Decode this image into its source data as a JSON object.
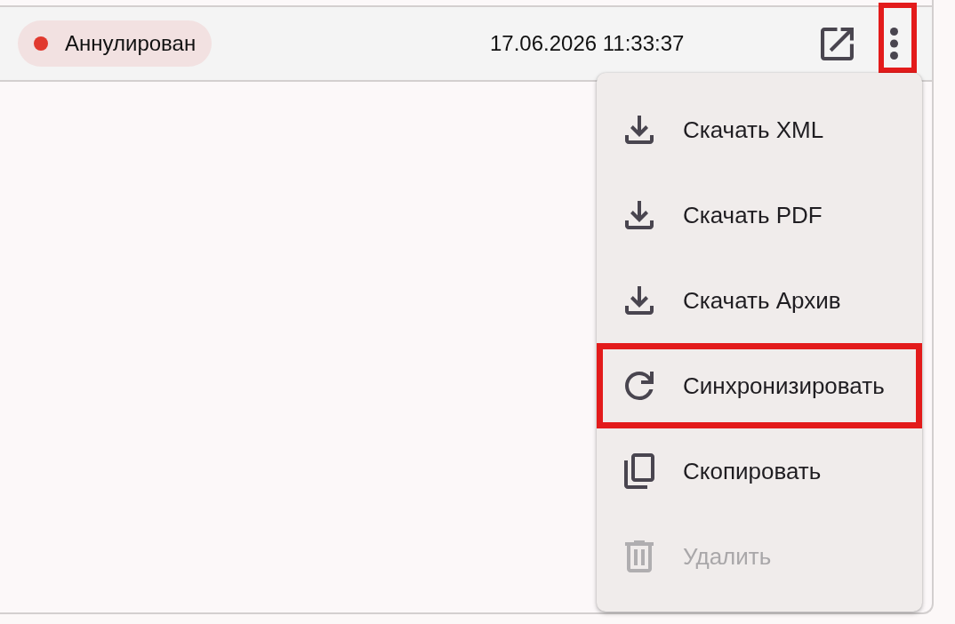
{
  "table": {
    "rows": [
      {
        "status": {
          "label": "Аннулирован",
          "color": "#e1392e"
        },
        "date": "17.06.2026 11:33:37",
        "actions": [
          {
            "kind": "open",
            "highlighted": false
          },
          {
            "kind": "more",
            "highlighted": true
          }
        ]
      }
    ]
  },
  "menu": {
    "items": [
      {
        "kind": "download",
        "label": "Скачать XML",
        "disabled": false,
        "highlighted": false
      },
      {
        "kind": "download",
        "label": "Скачать PDF",
        "disabled": false,
        "highlighted": false
      },
      {
        "kind": "download",
        "label": "Скачать Архив",
        "disabled": false,
        "highlighted": false
      },
      {
        "kind": "refresh",
        "label": "Синхронизировать",
        "disabled": false,
        "highlighted": true
      },
      {
        "kind": "copy",
        "label": "Скопировать",
        "disabled": false,
        "highlighted": false
      },
      {
        "kind": "delete",
        "label": "Удалить",
        "disabled": true,
        "highlighted": false
      }
    ]
  }
}
